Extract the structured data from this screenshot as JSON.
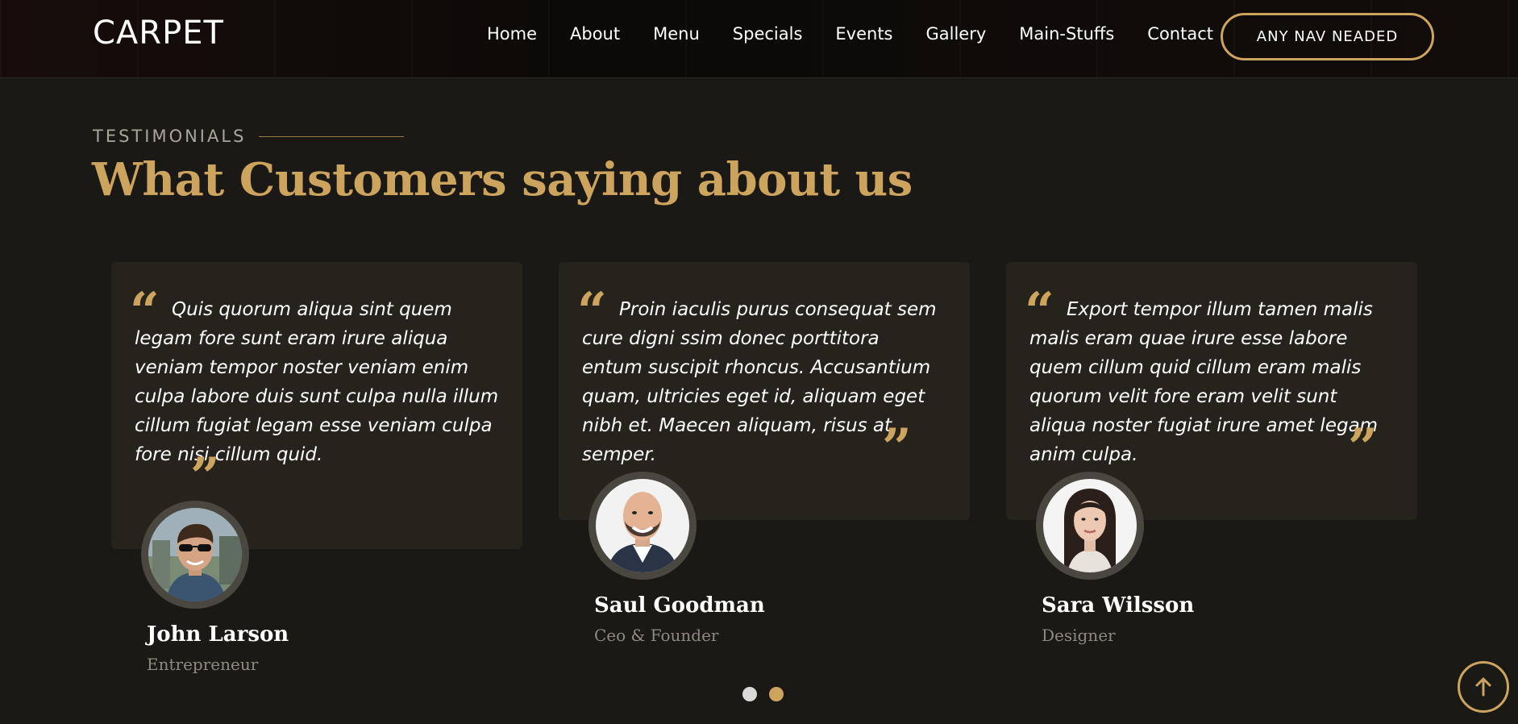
{
  "header": {
    "logo": "CARPET",
    "nav": [
      "Home",
      "About",
      "Menu",
      "Specials",
      "Events",
      "Gallery",
      "Main-Stuffs",
      "Contact"
    ],
    "cta_label": "ANY NAV NEADED"
  },
  "section": {
    "eyebrow": "TESTIMONIALS",
    "title": "What Customers saying about us"
  },
  "testimonials": [
    {
      "quote": "Quis quorum aliqua sint quem legam fore sunt eram irure aliqua veniam tempor noster veniam enim culpa labore duis sunt culpa nulla illum cillum fugiat legam esse veniam culpa fore nisi cillum quid.",
      "name": "John Larson",
      "role": "Entrepreneur",
      "avatar_icon": "man-sunglasses-avatar"
    },
    {
      "quote": "Proin iaculis purus consequat sem cure digni ssim donec porttitora entum suscipit rhoncus. Accusantium quam, ultricies eget id, aliquam eget nibh et. Maecen aliquam, risus at semper.",
      "name": "Saul Goodman",
      "role": "Ceo & Founder",
      "avatar_icon": "bald-man-avatar"
    },
    {
      "quote": "Export tempor illum tamen malis malis eram quae irure esse labore quem cillum quid cillum eram malis quorum velit fore eram velit sunt aliqua noster fugiat irure amet legam anim culpa.",
      "name": "Sara Wilsson",
      "role": "Designer",
      "avatar_icon": "woman-avatar"
    }
  ],
  "pagination": {
    "active_index": 1,
    "count": 2
  },
  "colors": {
    "accent": "#cda45e",
    "background": "#1b1915",
    "card": "#26231d"
  },
  "icons": {
    "quote_open": "left-quote-icon",
    "quote_close": "right-quote-icon",
    "back_to_top": "arrow-up-icon"
  }
}
